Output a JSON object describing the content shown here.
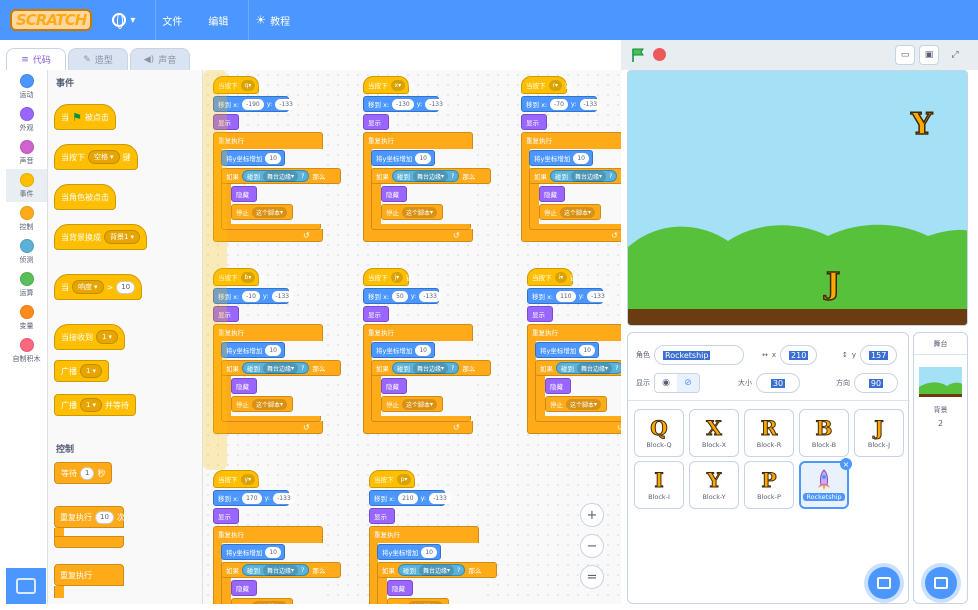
{
  "topbar": {
    "logo": "SCRATCH",
    "file": "文件",
    "edit": "编辑",
    "tutorials": "教程"
  },
  "tabs": {
    "code": "代码",
    "costumes": "造型",
    "sounds": "声音"
  },
  "categories": [
    {
      "label": "运动",
      "color": "#4c97ff"
    },
    {
      "label": "外观",
      "color": "#9966ff"
    },
    {
      "label": "声音",
      "color": "#cf63cf"
    },
    {
      "label": "事件",
      "color": "#ffbf00"
    },
    {
      "label": "控制",
      "color": "#ffab19"
    },
    {
      "label": "侦测",
      "color": "#5cb1d6"
    },
    {
      "label": "运算",
      "color": "#59c059"
    },
    {
      "label": "变量",
      "color": "#ff8c1a"
    },
    {
      "label": "自制积木",
      "color": "#ff6680"
    }
  ],
  "palette": {
    "events_title": "事件",
    "when_flag": "当",
    "when_flag_suffix": "被点击",
    "when_key": "当按下",
    "when_key_value": "空格",
    "when_key_suffix": "键",
    "when_sprite_clicked": "当角色被点击",
    "when_backdrop": "当背景换成",
    "when_backdrop_value": "背景1",
    "when_loudness": "当",
    "when_loudness_value": "响度",
    "when_loudness_op": ">",
    "when_loudness_num": "10",
    "when_receive": "当接收到",
    "when_receive_value": "1",
    "broadcast": "广播",
    "broadcast_value": "1",
    "broadcast_wait": "广播",
    "broadcast_wait_value": "1",
    "broadcast_wait_suffix": "并等待",
    "control_title": "控制",
    "wait": "等待",
    "wait_value": "1",
    "wait_suffix": "秒",
    "repeat": "重复执行",
    "repeat_value": "10",
    "repeat_suffix": "次",
    "forever": "重复执行"
  },
  "scripts": [
    {
      "key": "q",
      "x": "-190",
      "y": "-133"
    },
    {
      "key": "x",
      "x": "-130",
      "y": "-133"
    },
    {
      "key": "r",
      "x": "-70",
      "y": "-133"
    },
    {
      "key": "b",
      "x": "-10",
      "y": "-133"
    },
    {
      "key": "j",
      "x": "50",
      "y": "-133"
    },
    {
      "key": "i",
      "x": "110",
      "y": "-133"
    },
    {
      "key": "y",
      "x": "170",
      "y": "-133"
    },
    {
      "key": "p",
      "x": "210",
      "y": "-133"
    }
  ],
  "script_text": {
    "when_pressed": "当按下",
    "key_suffix": "键",
    "goto": "移到 x:",
    "goto_y": "y:",
    "show": "显示",
    "forever": "重复执行",
    "change_y": "将y坐标增加",
    "change_y_value": "10",
    "if": "如果",
    "touching": "碰到",
    "edge": "舞台边缘",
    "question": "?",
    "then": "那么",
    "hide": "隐藏",
    "stop": "停止",
    "stop_value": "这个脚本"
  },
  "stage": {
    "letter_y": "Y",
    "letter_j": "J"
  },
  "sprite_info": {
    "sprite_label": "角色",
    "sprite_name": "Rocketship",
    "x_label": "x",
    "x_value": "210",
    "y_label": "y",
    "y_value": "157",
    "show_label": "显示",
    "size_label": "大小",
    "size_value": "30",
    "direction_label": "方向",
    "direction_value": "90"
  },
  "sprites": [
    {
      "letter": "Q",
      "name": "Block-Q"
    },
    {
      "letter": "X",
      "name": "Block-X"
    },
    {
      "letter": "R",
      "name": "Block-R"
    },
    {
      "letter": "B",
      "name": "Block-B"
    },
    {
      "letter": "J",
      "name": "Block-J"
    },
    {
      "letter": "I",
      "name": "Block-I"
    },
    {
      "letter": "Y",
      "name": "Block-Y"
    },
    {
      "letter": "P",
      "name": "Block-P"
    },
    {
      "letter": "",
      "name": "Rocketship"
    }
  ],
  "stage_pane": {
    "title": "舞台",
    "backdrops_label": "背景",
    "backdrops_count": "2"
  },
  "zoom": {
    "in": "+",
    "out": "−",
    "reset": "="
  }
}
